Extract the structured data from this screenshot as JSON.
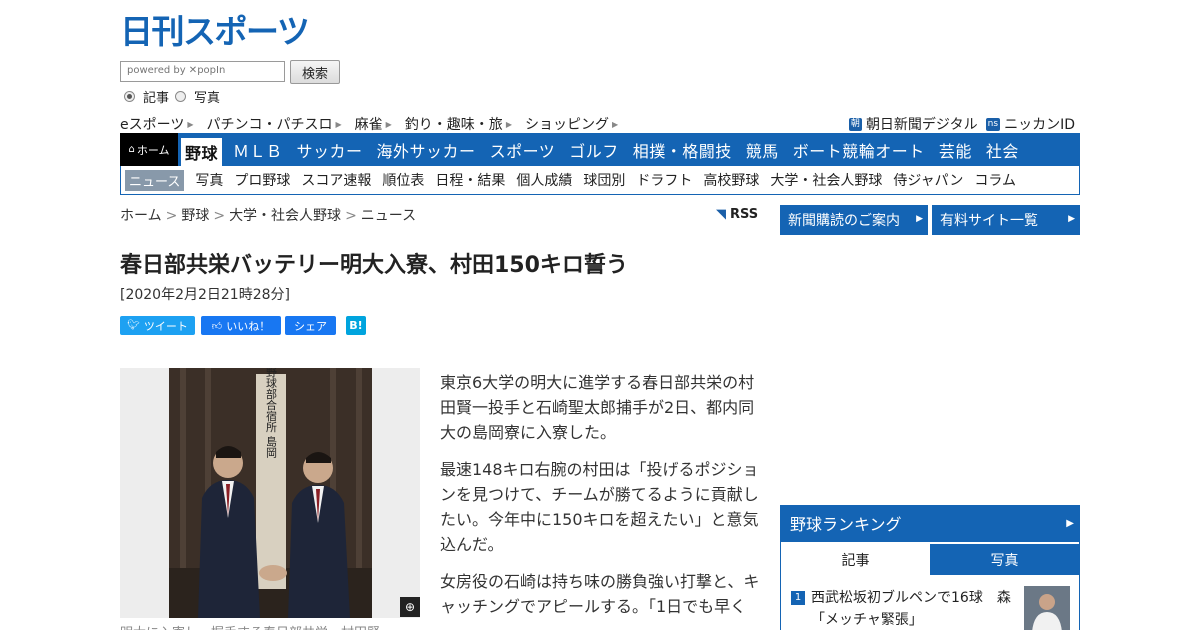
{
  "logo": {
    "text": "日刊スポーツ",
    "color": "#1464b4"
  },
  "search": {
    "placeholder": "powered by ✕popIn",
    "button": "検索",
    "options": [
      "記事",
      "写真"
    ],
    "selected": "記事"
  },
  "subnav": [
    "eスポーツ",
    "パチンコ・パチスロ",
    "麻雀",
    "釣り・趣味・旅",
    "ショッピング"
  ],
  "partners": [
    {
      "badge": "朝",
      "label": "朝日新聞デジタル"
    },
    {
      "badge": "ns",
      "label": "ニッカンID"
    }
  ],
  "mainnav": {
    "home": "ホーム",
    "categories": [
      "野球",
      "ＭＬＢ",
      "サッカー",
      "海外サッカー",
      "スポーツ",
      "ゴルフ",
      "相撲・格闘技",
      "競馬",
      "ボート競輪オート",
      "芸能",
      "社会"
    ],
    "active": "野球"
  },
  "secnav": {
    "items": [
      "ニュース",
      "写真",
      "プロ野球",
      "スコア速報",
      "順位表",
      "日程・結果",
      "個人成績",
      "球団別",
      "ドラフト",
      "高校野球",
      "大学・社会人野球",
      "侍ジャパン",
      "コラム"
    ],
    "active": "ニュース"
  },
  "breadcrumb": [
    "ホーム",
    "野球",
    "大学・社会人野球",
    "ニュース"
  ],
  "rss": "RSS",
  "article": {
    "headline": "春日部共栄バッテリー明大入寮、村田150キロ誓う",
    "date": "[2020年2月2日21時28分]",
    "share": {
      "tweet": "ツイート",
      "like": "いいね！",
      "share": "シェア",
      "hatena": "B!"
    },
    "caption": "明大に入寮し、握手する春日部共栄・村田賢",
    "paragraphs": [
      "東京6大学の明大に進学する春日部共栄の村田賢一投手と石崎聖太郎捕手が2日、都内同大の島岡寮に入寮した。",
      "最速148キロ右腕の村田は「投げるポジションを見つけて、チームが勝てるように貢献したい。今年中に150キロを超えたい」と意気込んだ。",
      "女房役の石崎は持ち味の勝負強い打撃と、キャッチングでアピールする。「1日でも早く"
    ],
    "sign": "明治大学野球部合宿所 島岡"
  },
  "sidebar": {
    "buttons": [
      "新聞購読のご案内",
      "有料サイト一覧"
    ],
    "ranking": {
      "title": "野球ランキング",
      "tabs": [
        "記事",
        "写真"
      ],
      "active_tab": "記事",
      "items": [
        {
          "rank": "1",
          "text": "西武松坂初ブルペンで16球　森「メッチャ緊張」"
        }
      ]
    }
  }
}
